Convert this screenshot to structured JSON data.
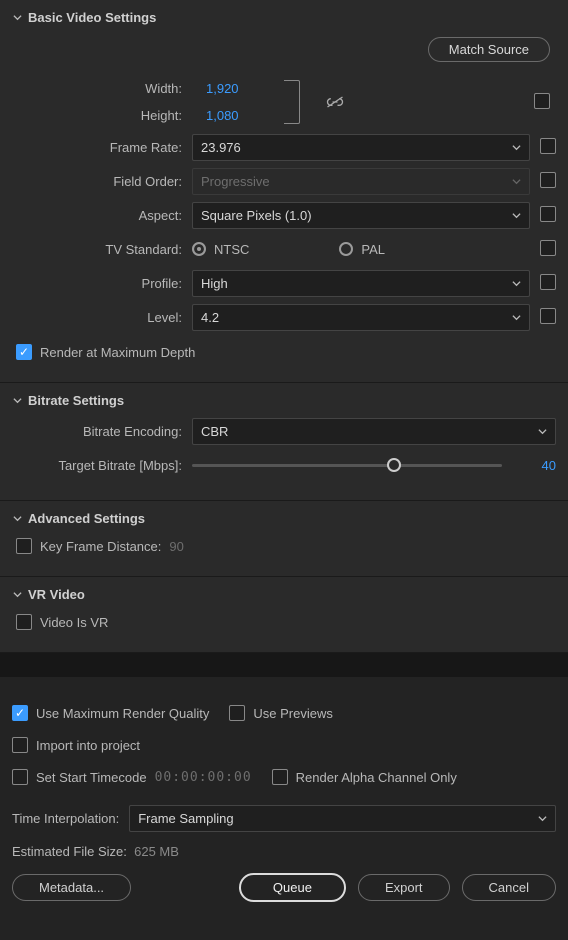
{
  "basic": {
    "title": "Basic Video Settings",
    "match_source": "Match Source",
    "width_label": "Width:",
    "width": "1,920",
    "height_label": "Height:",
    "height": "1,080",
    "frame_rate_label": "Frame Rate:",
    "frame_rate": "23.976",
    "field_order_label": "Field Order:",
    "field_order": "Progressive",
    "aspect_label": "Aspect:",
    "aspect": "Square Pixels (1.0)",
    "tv_standard_label": "TV Standard:",
    "tv_ntsc": "NTSC",
    "tv_pal": "PAL",
    "profile_label": "Profile:",
    "profile": "High",
    "level_label": "Level:",
    "level": "4.2",
    "render_max_depth": "Render at Maximum Depth"
  },
  "bitrate": {
    "title": "Bitrate Settings",
    "encoding_label": "Bitrate Encoding:",
    "encoding": "CBR",
    "target_label": "Target Bitrate [Mbps]:",
    "target_value": "40",
    "target_pct": 65
  },
  "advanced": {
    "title": "Advanced Settings",
    "keyframe_label": "Key Frame Distance:",
    "keyframe_value": "90"
  },
  "vr": {
    "title": "VR Video",
    "is_vr_label": "Video Is VR"
  },
  "footer": {
    "max_quality": "Use Maximum Render Quality",
    "use_previews": "Use Previews",
    "import_project": "Import into project",
    "set_start_tc": "Set Start Timecode",
    "tc_value": "00:00:00:00",
    "render_alpha": "Render Alpha Channel Only",
    "time_interp_label": "Time Interpolation:",
    "time_interp": "Frame Sampling",
    "est_label": "Estimated File Size:",
    "est_value": "625 MB",
    "metadata_btn": "Metadata...",
    "queue_btn": "Queue",
    "export_btn": "Export",
    "cancel_btn": "Cancel"
  }
}
